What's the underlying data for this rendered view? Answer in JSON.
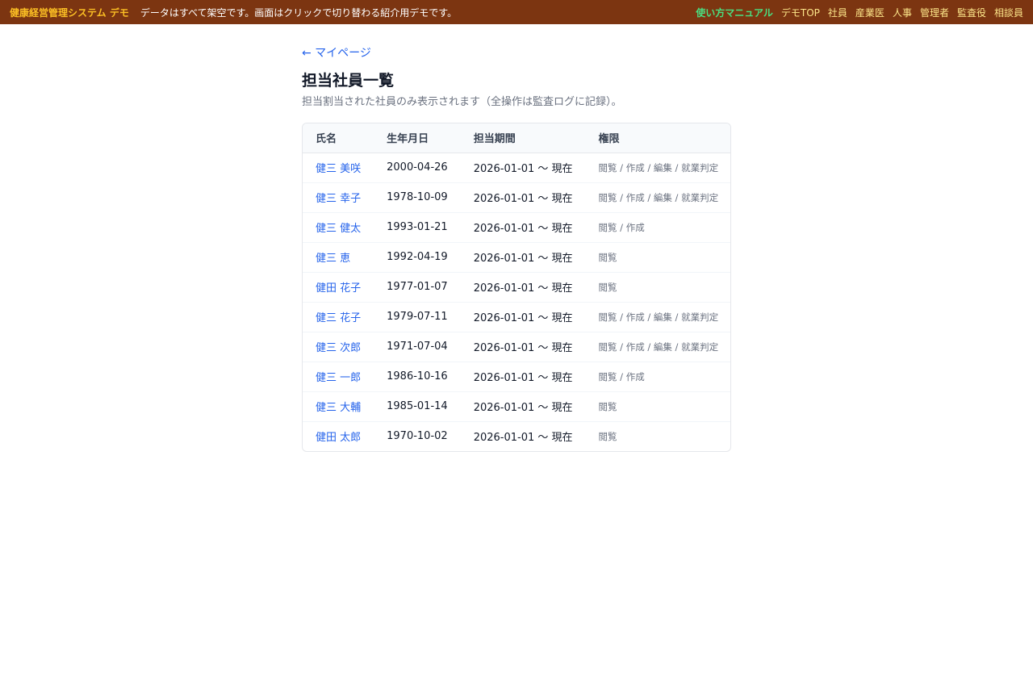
{
  "topbar": {
    "brand": "健康経営管理システム デモ",
    "notice": "データはすべて架空です。画面はクリックで切り替わる紹介用デモです。",
    "nav": [
      "使い方マニュアル",
      "デモTOP",
      "社員",
      "産業医",
      "人事",
      "管理者",
      "監査役",
      "相談員"
    ]
  },
  "page": {
    "back": "← マイページ",
    "title": "担当社員一覧",
    "subtitle": "担当割当された社員のみ表示されます（全操作は監査ログに記録）。"
  },
  "table": {
    "headers": [
      "氏名",
      "生年月日",
      "担当期間",
      "権限"
    ],
    "rows": [
      {
        "name": "健三 美咲",
        "birth": "2000-04-26",
        "period": "2026-01-01 〜 現在",
        "perm": "閲覧 / 作成 / 編集 / 就業判定"
      },
      {
        "name": "健三 幸子",
        "birth": "1978-10-09",
        "period": "2026-01-01 〜 現在",
        "perm": "閲覧 / 作成 / 編集 / 就業判定"
      },
      {
        "name": "健三 健太",
        "birth": "1993-01-21",
        "period": "2026-01-01 〜 現在",
        "perm": "閲覧 / 作成"
      },
      {
        "name": "健三 恵",
        "birth": "1992-04-19",
        "period": "2026-01-01 〜 現在",
        "perm": "閲覧"
      },
      {
        "name": "健田 花子",
        "birth": "1977-01-07",
        "period": "2026-01-01 〜 現在",
        "perm": "閲覧"
      },
      {
        "name": "健三 花子",
        "birth": "1979-07-11",
        "period": "2026-01-01 〜 現在",
        "perm": "閲覧 / 作成 / 編集 / 就業判定"
      },
      {
        "name": "健三 次郎",
        "birth": "1971-07-04",
        "period": "2026-01-01 〜 現在",
        "perm": "閲覧 / 作成 / 編集 / 就業判定"
      },
      {
        "name": "健三 一郎",
        "birth": "1986-10-16",
        "period": "2026-01-01 〜 現在",
        "perm": "閲覧 / 作成"
      },
      {
        "name": "健三 大輔",
        "birth": "1985-01-14",
        "period": "2026-01-01 〜 現在",
        "perm": "閲覧"
      },
      {
        "name": "健田 太郎",
        "birth": "1970-10-02",
        "period": "2026-01-01 〜 現在",
        "perm": "閲覧"
      }
    ]
  },
  "colors": {
    "topbar_bg": "#7c3511",
    "brand": "#fbbf24",
    "manual_link": "#4ade80",
    "nav_link": "#fde68a",
    "link": "#2563eb"
  }
}
